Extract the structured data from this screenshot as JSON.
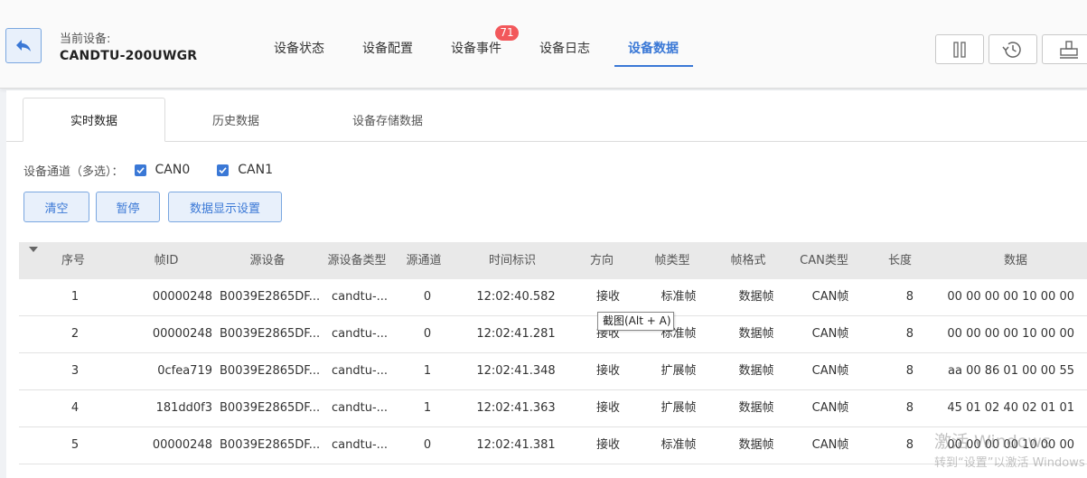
{
  "header": {
    "device_label": "当前设备:",
    "device_name": "CANDTU-200UWGR",
    "tabs": [
      {
        "label": "设备状态"
      },
      {
        "label": "设备配置"
      },
      {
        "label": "设备事件"
      },
      {
        "label": "设备日志"
      },
      {
        "label": "设备数据"
      }
    ],
    "active_tab": "设备数据",
    "event_badge": "71",
    "tools": [
      "pause-icon",
      "history-icon",
      "dock-icon"
    ]
  },
  "subtabs": [
    {
      "label": "实时数据"
    },
    {
      "label": "历史数据"
    },
    {
      "label": "设备存储数据"
    }
  ],
  "channels": {
    "label": "设备通道（多选）：",
    "items": [
      {
        "label": "CAN0",
        "checked": true
      },
      {
        "label": "CAN1",
        "checked": true
      }
    ]
  },
  "actions": {
    "clear": "清空",
    "pause": "暂停",
    "display_settings": "数据显示设置"
  },
  "table": {
    "columns": [
      "序号",
      "帧ID",
      "源设备",
      "源设备类型",
      "源通道",
      "时间标识",
      "方向",
      "帧类型",
      "帧格式",
      "CAN类型",
      "长度",
      "数据"
    ],
    "rows": [
      [
        "1",
        "00000248",
        "B0039E2865DF...",
        "candtu-...",
        "0",
        "12:02:40.582",
        "接收",
        "标准帧",
        "数据帧",
        "CAN帧",
        "8",
        "00 00 00 00 10 00 00"
      ],
      [
        "2",
        "00000248",
        "B0039E2865DF...",
        "candtu-...",
        "0",
        "12:02:41.281",
        "接收",
        "标准帧",
        "数据帧",
        "CAN帧",
        "8",
        "00 00 00 00 10 00 00"
      ],
      [
        "3",
        "0cfea719",
        "B0039E2865DF...",
        "candtu-...",
        "1",
        "12:02:41.348",
        "接收",
        "扩展帧",
        "数据帧",
        "CAN帧",
        "8",
        "aa 00 86 01 00 00 55"
      ],
      [
        "4",
        "181dd0f3",
        "B0039E2865DF...",
        "candtu-...",
        "1",
        "12:02:41.363",
        "接收",
        "扩展帧",
        "数据帧",
        "CAN帧",
        "8",
        "45 01 02 40 02 01 01"
      ],
      [
        "5",
        "00000248",
        "B0039E2865DF...",
        "candtu-...",
        "0",
        "12:02:41.381",
        "接收",
        "标准帧",
        "数据帧",
        "CAN帧",
        "8",
        "00 00 00 00 10 00 00"
      ]
    ]
  },
  "tooltip": "截图(Alt + A)",
  "watermark": {
    "line1": "激活 Windows",
    "line2": "转到“设置”以激活 Windows"
  },
  "colors": {
    "accent": "#3a78d6",
    "badge": "#f2585b",
    "header_bg": "#fafafa",
    "table_header_bg": "#e9e9e9"
  }
}
